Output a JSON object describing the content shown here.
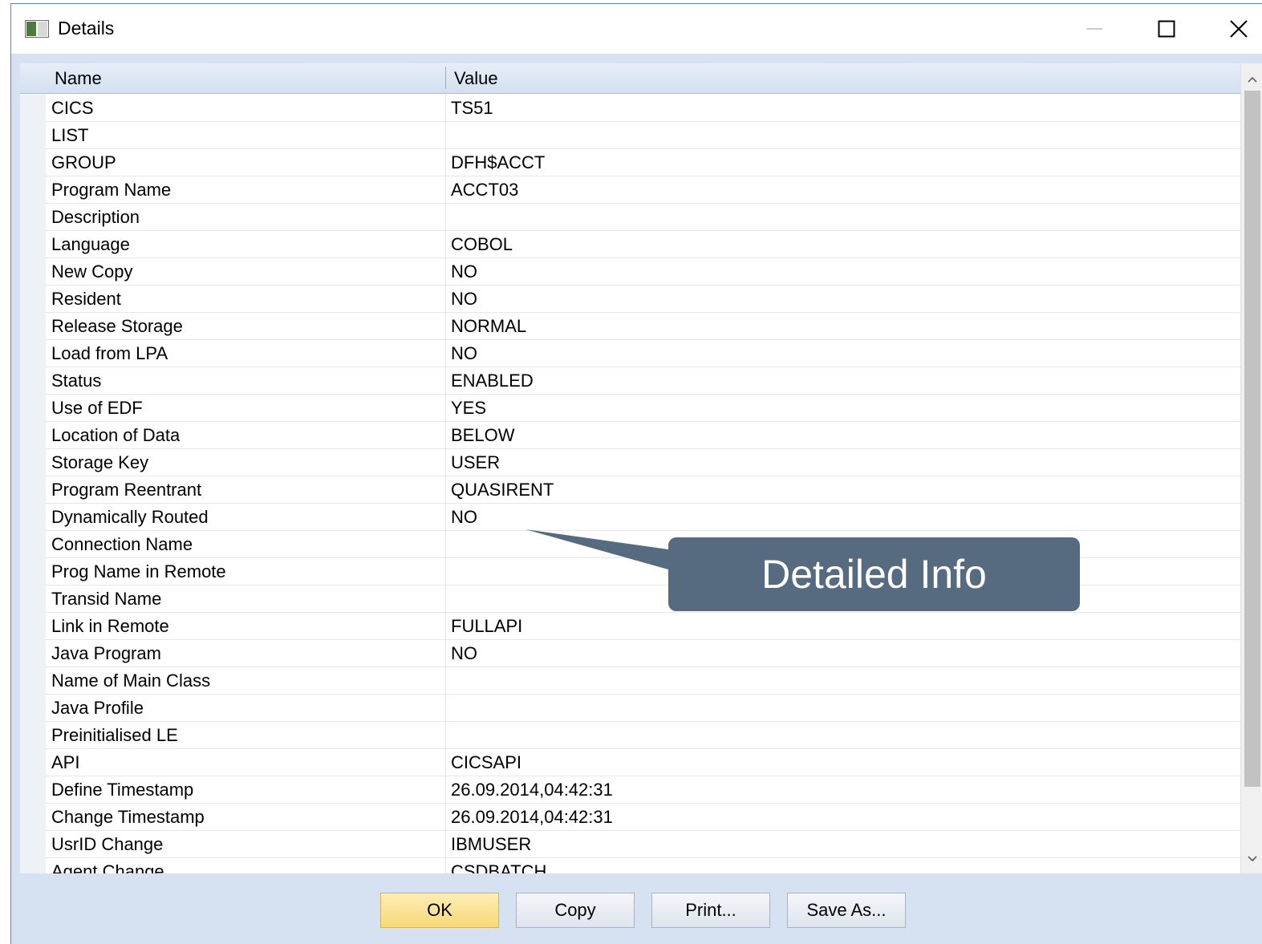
{
  "window": {
    "title": "Details"
  },
  "list": {
    "columns": {
      "name": "Name",
      "value": "Value"
    },
    "rows": [
      {
        "name": "CICS",
        "value": "TS51"
      },
      {
        "name": "LIST",
        "value": ""
      },
      {
        "name": "GROUP",
        "value": "DFH$ACCT"
      },
      {
        "name": "Program Name",
        "value": "ACCT03"
      },
      {
        "name": "Description",
        "value": ""
      },
      {
        "name": "Language",
        "value": "COBOL"
      },
      {
        "name": "New Copy",
        "value": "NO"
      },
      {
        "name": "Resident",
        "value": "NO"
      },
      {
        "name": "Release Storage",
        "value": "NORMAL"
      },
      {
        "name": "Load from LPA",
        "value": "NO"
      },
      {
        "name": "Status",
        "value": "ENABLED"
      },
      {
        "name": "Use of EDF",
        "value": "YES"
      },
      {
        "name": "Location of Data",
        "value": "BELOW"
      },
      {
        "name": "Storage Key",
        "value": "USER"
      },
      {
        "name": "Program Reentrant",
        "value": "QUASIRENT"
      },
      {
        "name": "Dynamically Routed",
        "value": "NO"
      },
      {
        "name": "Connection Name",
        "value": ""
      },
      {
        "name": "Prog Name in Remote",
        "value": ""
      },
      {
        "name": "Transid Name",
        "value": ""
      },
      {
        "name": "Link in Remote",
        "value": "FULLAPI"
      },
      {
        "name": "Java Program",
        "value": "NO"
      },
      {
        "name": "Name of Main Class",
        "value": ""
      },
      {
        "name": "Java Profile",
        "value": ""
      },
      {
        "name": "Preinitialised LE",
        "value": ""
      },
      {
        "name": "API",
        "value": "CICSAPI"
      },
      {
        "name": "Define Timestamp",
        "value": "26.09.2014,04:42:31"
      },
      {
        "name": "Change Timestamp",
        "value": "26.09.2014,04:42:31"
      },
      {
        "name": "UsrID Change",
        "value": "IBMUSER"
      },
      {
        "name": "Agent Change",
        "value": "CSDBATCH"
      }
    ]
  },
  "callout": {
    "text": "Detailed Info"
  },
  "buttons": {
    "ok": "OK",
    "copy": "Copy",
    "print": "Print...",
    "save_as": "Save As..."
  }
}
